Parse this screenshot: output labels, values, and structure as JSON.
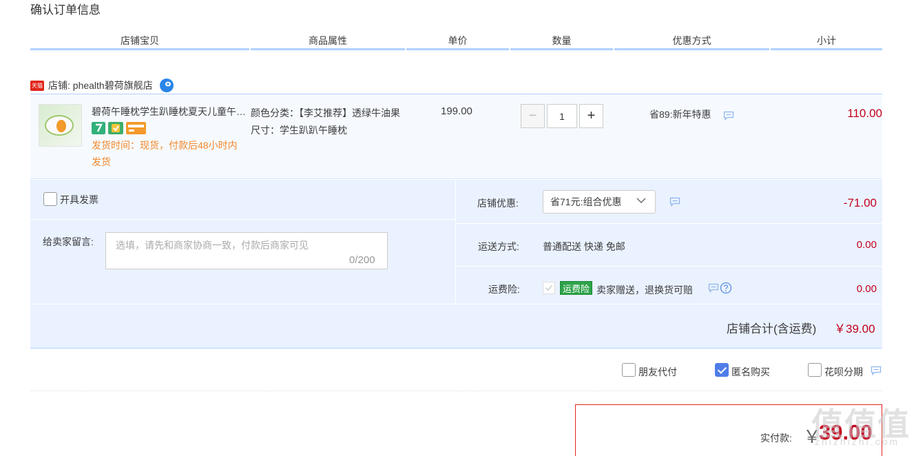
{
  "page": {
    "title": "确认订单信息"
  },
  "columns": [
    "店铺宝贝",
    "商品属性",
    "单价",
    "数量",
    "优惠方式",
    "小计"
  ],
  "shop": {
    "platform_badge": "天猫",
    "name": "店铺: phealth碧荷旗舰店"
  },
  "item": {
    "title": "碧荷午睡枕学生趴睡枕夏天儿童午休枕头趴趴枕",
    "shipping_time": "发货时间：现货，付款后48小时内发货",
    "props": {
      "color_label": "颜色分类：【李艾推荐】透绿牛油果",
      "size_label": "尺寸：学生趴趴午睡枕"
    },
    "unit_price": "199.00",
    "quantity": "1",
    "promotion": "省89:新年特惠",
    "subtotal": "110.00"
  },
  "invoice": {
    "label": "开具发票"
  },
  "message": {
    "label": "给卖家留言:",
    "placeholder": "选填，请先和商家协商一致，付款后商家可见",
    "count": "0/200"
  },
  "shop_discount": {
    "label": "店铺优惠:",
    "selected": "省71元:组合优惠",
    "value": "-71.00"
  },
  "delivery": {
    "label": "运送方式:",
    "text": "普通配送 快递 免邮",
    "value": "0.00"
  },
  "insurance": {
    "label": "运费险:",
    "badge": "运费险",
    "text": "卖家赠送，退换货可赔",
    "value": "0.00"
  },
  "shop_total": {
    "label": "店铺合计(含运费)",
    "value": "￥39.00"
  },
  "options": {
    "friend_pay": "朋友代付",
    "anonymous": "匿名购买",
    "huabei": "花呗分期"
  },
  "payment": {
    "label": "实付款:",
    "currency": "￥",
    "amount": "39.00"
  },
  "watermark": {
    "cn": "值值值",
    "en": "zhizhizhi.com"
  },
  "colors": {
    "price_red": "#c4001d",
    "accent_blue": "#b2d1ff",
    "panel_blue": "#eaf2ff",
    "ship_orange": "#f3882b"
  },
  "icons": [
    "tmall-logo",
    "wangwang-chat-icon",
    "chat-bubble-icon",
    "chevron-down-icon",
    "help-icon",
    "check-icon"
  ]
}
